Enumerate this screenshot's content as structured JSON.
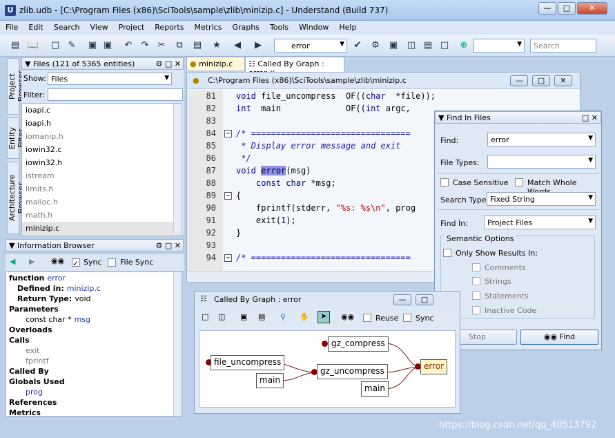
{
  "window": {
    "title": "zlib.udb - [C:\\Program Files (x86)\\SciTools\\sample\\zlib\\minizip.c] - Understand (Build 737)"
  },
  "menu": [
    "File",
    "Edit",
    "Search",
    "View",
    "Project",
    "Reports",
    "Metrics",
    "Graphs",
    "Tools",
    "Window",
    "Help"
  ],
  "toolbar": {
    "entity_combo": "error",
    "search_placeholder": "Search"
  },
  "left_tabs": [
    "Project Browser",
    "Entity Filter",
    "Architecture Browser"
  ],
  "files_pane": {
    "title": "Files (121 of 5365 entities)",
    "show_label": "Show:",
    "show_value": "Files",
    "filter_label": "Filter:",
    "items": [
      {
        "name": "ioapi.c",
        "dim": false
      },
      {
        "name": "ioapi.h",
        "dim": false
      },
      {
        "name": "iomanip.h",
        "dim": true
      },
      {
        "name": "iowin32.c",
        "dim": false
      },
      {
        "name": "iowin32.h",
        "dim": false
      },
      {
        "name": "istream",
        "dim": true
      },
      {
        "name": "limits.h",
        "dim": true
      },
      {
        "name": "malloc.h",
        "dim": true
      },
      {
        "name": "math.h",
        "dim": true
      },
      {
        "name": "minizip.c",
        "dim": false
      }
    ]
  },
  "tabs": [
    {
      "label": "minizip.c"
    },
    {
      "label": "Called By Graph : error"
    }
  ],
  "editor": {
    "path": "C:\\Program Files (x86)\\SciTools\\sample\\zlib\\minizip.c",
    "lines": [
      {
        "n": "81",
        "html": "<span class=\"kw\">void</span> file_uncompress  OF((<span class=\"kw\">char</span>  *file));"
      },
      {
        "n": "82",
        "html": "<span class=\"kw\">int</span>  main             OF((<span class=\"kw\">int</span> argc, "
      },
      {
        "n": "83",
        "html": ""
      },
      {
        "n": "84",
        "html": "<span class=\"cm\">/* ================================</span>"
      },
      {
        "n": "85",
        "html": "<span class=\"cm\"> * Display error message and exit</span>"
      },
      {
        "n": "86",
        "html": "<span class=\"cm\"> */</span>"
      },
      {
        "n": "87",
        "html": "<span class=\"kw\">void</span> <span class=\"hl\">error</span>(msg)"
      },
      {
        "n": "88",
        "html": "    <span class=\"kw\">const</span> <span class=\"kw\">char</span> *msg;"
      },
      {
        "n": "89",
        "html": "{"
      },
      {
        "n": "90",
        "html": "    fprintf(stderr, <span class=\"str\">\"%s: %s\\n\"</span>, prog"
      },
      {
        "n": "91",
        "html": "    exit(<span class=\"num\">1</span>);"
      },
      {
        "n": "92",
        "html": "}"
      },
      {
        "n": "93",
        "html": ""
      },
      {
        "n": "94",
        "html": "<span class=\"cm\">/* ================================</span>"
      }
    ]
  },
  "find": {
    "title": "Find In Files",
    "find_label": "Find:",
    "find_value": "error",
    "filetypes_label": "File Types:",
    "case_sensitive": "Case Sensitive",
    "match_whole": "Match Whole Words",
    "search_type_label": "Search Type:",
    "search_type_value": "Fixed String",
    "find_in_label": "Find In:",
    "find_in_value": "Project Files",
    "semantic_title": "Semantic Options",
    "only_show": "Only Show Results In:",
    "options": [
      "Comments",
      "Strings",
      "Statements",
      "Inactive Code"
    ],
    "stop": "Stop",
    "find_btn": "Find"
  },
  "graph": {
    "title": "Called By Graph : error",
    "reuse": "Reuse",
    "sync": "Sync",
    "nodes": [
      "gz_compress",
      "file_uncompress",
      "main",
      "gz_uncompress",
      "main",
      "error"
    ]
  },
  "info": {
    "title": "Information Browser",
    "sync": "Sync",
    "file_sync": "File Sync",
    "rows": [
      {
        "k": "function",
        "v": "error",
        "cls": "bold",
        "vcls": "link"
      },
      {
        "k": "Defined in:",
        "v": "minizip.c",
        "cls": "bold",
        "vcls": "link"
      },
      {
        "k": "Return Type:",
        "v": "void",
        "cls": "bold",
        "vcls": ""
      },
      {
        "k": "Parameters",
        "v": "",
        "cls": "bold",
        "vcls": ""
      },
      {
        "k": "const char *",
        "v": "msg",
        "cls": "",
        "vcls": "link"
      },
      {
        "k": "Overloads",
        "v": "",
        "cls": "bold",
        "vcls": ""
      },
      {
        "k": "Calls",
        "v": "",
        "cls": "bold",
        "vcls": ""
      },
      {
        "k": "exit",
        "v": "",
        "cls": "gray",
        "vcls": ""
      },
      {
        "k": "fprintf",
        "v": "",
        "cls": "gray",
        "vcls": ""
      },
      {
        "k": "Called By",
        "v": "",
        "cls": "bold",
        "vcls": ""
      },
      {
        "k": "Globals Used",
        "v": "",
        "cls": "bold",
        "vcls": ""
      },
      {
        "k": "prog",
        "v": "",
        "cls": "link",
        "vcls": ""
      },
      {
        "k": "References",
        "v": "",
        "cls": "bold",
        "vcls": ""
      },
      {
        "k": "Metrics",
        "v": "",
        "cls": "bold",
        "vcls": ""
      }
    ]
  },
  "watermark": "https://blog.csdn.net/qq_40513792"
}
